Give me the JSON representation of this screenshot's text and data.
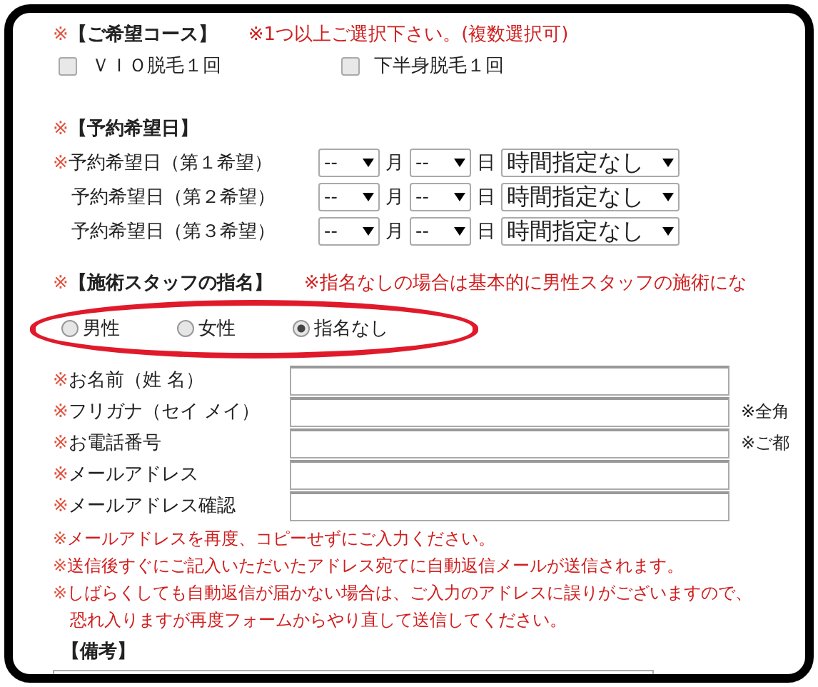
{
  "course": {
    "mark": "※",
    "heading": "【ご希望コース】",
    "note": "※1つ以上ご選択下さい。(複数選択可)",
    "options": [
      {
        "label": "ＶＩＯ脱毛１回",
        "checked": false
      },
      {
        "label": "下半身脱毛１回",
        "checked": false
      }
    ]
  },
  "reservation": {
    "mark": "※",
    "heading": "【予約希望日】",
    "rows": [
      {
        "mark": "※",
        "label": "予約希望日（第１希望）",
        "month": "--",
        "month_unit": "月",
        "day": "--",
        "day_unit": "日",
        "time": "時間指定なし"
      },
      {
        "label": "予約希望日（第２希望）",
        "month": "--",
        "month_unit": "月",
        "day": "--",
        "day_unit": "日",
        "time": "時間指定なし"
      },
      {
        "label": "予約希望日（第３希望）",
        "month": "--",
        "month_unit": "月",
        "day": "--",
        "day_unit": "日",
        "time": "時間指定なし"
      }
    ]
  },
  "staff": {
    "mark": "※",
    "heading": "【施術スタッフの指名】",
    "note": "※指名なしの場合は基本的に男性スタッフの施術にな",
    "options": [
      {
        "label": "男性",
        "selected": false
      },
      {
        "label": "女性",
        "selected": false
      },
      {
        "label": "指名なし",
        "selected": true
      }
    ]
  },
  "fields": [
    {
      "mark": "※",
      "label": "お名前（姓 名）"
    },
    {
      "mark": "※",
      "label": "フリガナ（セイ メイ）",
      "hint": "※全角"
    },
    {
      "mark": "※",
      "label": "お電話番号",
      "hint": "※ご都"
    },
    {
      "mark": "※",
      "label": "メールアドレス"
    },
    {
      "mark": "※",
      "label": "メールアドレス確認"
    }
  ],
  "notes": [
    {
      "mark": "※",
      "text": "メールアドレスを再度、コピーせずにご入力ください。"
    },
    {
      "mark": "※",
      "text": "送信後すぐにご記入いただいたアドレス宛てに自動返信メールが送信されます。"
    },
    {
      "mark": "※",
      "text": "しばらくしても自動返信が届かない場合は、ご入力のアドレスに誤りがございますので、"
    },
    {
      "text": "恐れ入りますが再度フォームからやり直して送信してください。"
    }
  ],
  "remarks": {
    "heading": "【備考】"
  }
}
